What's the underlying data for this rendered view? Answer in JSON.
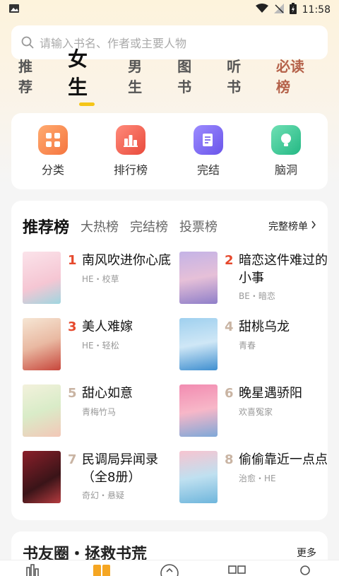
{
  "status": {
    "time": "11:58"
  },
  "search": {
    "placeholder": "请输入书名、作者或主要人物"
  },
  "tabs": [
    {
      "label": "推荐"
    },
    {
      "label": "女生"
    },
    {
      "label": "男生"
    },
    {
      "label": "图书"
    },
    {
      "label": "听书"
    },
    {
      "label": "必读榜"
    }
  ],
  "quick": [
    {
      "label": "分类",
      "icon": "category-icon",
      "color": "#f7874f"
    },
    {
      "label": "排行榜",
      "icon": "ranking-icon",
      "color": "#ee5b4b"
    },
    {
      "label": "完结",
      "icon": "finished-book-icon",
      "color": "#7b6bf0"
    },
    {
      "label": "脑洞",
      "icon": "bulb-icon",
      "color": "#33c48f"
    }
  ],
  "rank": {
    "tabs": [
      "推荐榜",
      "大热榜",
      "完结榜",
      "投票榜"
    ],
    "more": "完整榜单",
    "books": [
      {
        "rank": "1",
        "title": "南风吹进你心底",
        "tags": "HE・校草"
      },
      {
        "rank": "2",
        "title": "暗恋这件难过的小事",
        "tags": "BE・暗恋"
      },
      {
        "rank": "3",
        "title": "美人难嫁",
        "tags": "HE・轻松"
      },
      {
        "rank": "4",
        "title": "甜桃乌龙",
        "tags": "青春"
      },
      {
        "rank": "5",
        "title": "甜心如意",
        "tags": "青梅竹马"
      },
      {
        "rank": "6",
        "title": "晚星遇骄阳",
        "tags": "欢喜冤家"
      },
      {
        "rank": "7",
        "title": "民调局异闻录（全8册）",
        "tags": "奇幻・悬疑"
      },
      {
        "rank": "8",
        "title": "偷偷靠近一点点",
        "tags": "治愈・HE"
      }
    ]
  },
  "circle": {
    "title": "书友圈・拯救书荒",
    "more": "更多"
  }
}
